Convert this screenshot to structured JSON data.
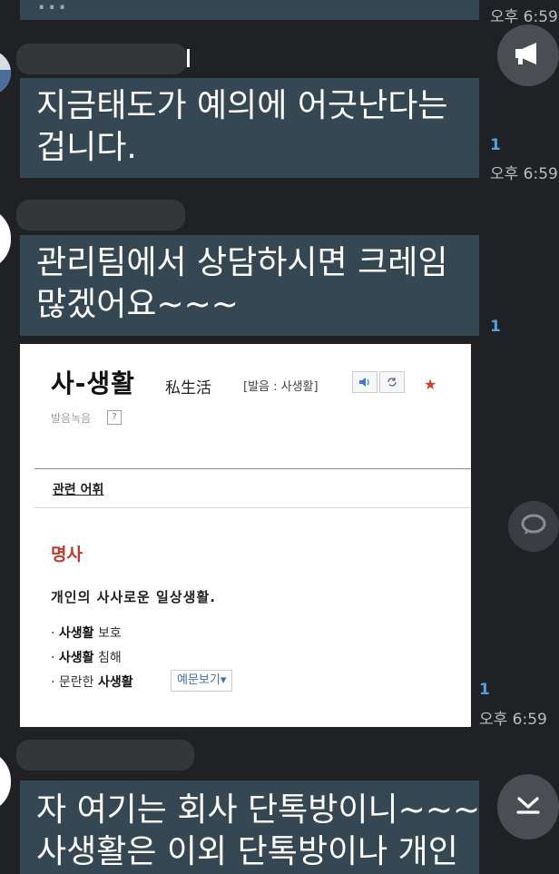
{
  "messages": [
    {
      "id": "m0",
      "text_lines": [
        "..."
      ],
      "read_count": "",
      "time": "오후 6:59"
    },
    {
      "id": "m1",
      "text_lines": [
        "지금태도가 예의에 어긋난다는",
        "겁니다."
      ],
      "read_count": "1",
      "time": "오후 6:59"
    },
    {
      "id": "m2",
      "text_lines": [
        "관리팀에서 상담하시면 크레임",
        "많겠어요~~~"
      ],
      "read_count": "1",
      "time": ""
    },
    {
      "id": "m3",
      "read_count": "1",
      "time": "오후 6:59"
    },
    {
      "id": "m4",
      "text_lines": [
        "자 여기는 회사 단톡방이니~~~",
        "사생활은 이외 단톡방이나 개인"
      ],
      "read_count": "",
      "time": ""
    }
  ],
  "dictionary": {
    "headword": "사-생활",
    "hanja": "私生活",
    "pronunciation": "[발음 : 사생활]",
    "play_icon": "speaker-icon",
    "replay_icon": "repeat-icon",
    "star_icon": "star-icon",
    "recording_label": "발음녹음",
    "help_mark": "?",
    "related_tab": "관련 어휘",
    "pos": "명사",
    "definition": "개인의 사사로운 일상생활.",
    "examples": [
      {
        "prefix": "· ",
        "bold": "사생활",
        "rest": " 보호"
      },
      {
        "prefix": "· ",
        "bold": "사생활",
        "rest": " 침해"
      },
      {
        "prefix": "· 문란한 ",
        "bold": "사생활",
        "rest": ""
      }
    ],
    "example_button": "예문보기▾"
  },
  "buttons": {
    "notice_icon": "megaphone-icon",
    "speech_icon": "speech-bubble-icon",
    "scroll_icon": "chevron-down-icon"
  },
  "colors": {
    "background": "#202124",
    "bubble": "#354752",
    "read_count": "#4fa3e0",
    "pos": "#c0392b"
  }
}
